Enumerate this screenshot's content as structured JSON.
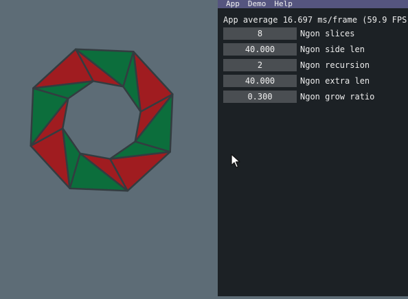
{
  "menu": [
    "App",
    "Demo",
    "Help"
  ],
  "fps_text": "App average 16.697 ms/frame (59.9 FPS)",
  "params": [
    {
      "value": "8",
      "label": "Ngon slices"
    },
    {
      "value": "40.000",
      "label": "Ngon side len"
    },
    {
      "value": "2",
      "label": "Ngon recursion"
    },
    {
      "value": "40.000",
      "label": "Ngon extra len"
    },
    {
      "value": "0.300",
      "label": "Ngon grow ratio"
    }
  ],
  "colors": {
    "background": "#5d6c76",
    "panel": "#1c2125",
    "menubar": "#55557f",
    "red": "#a01c20",
    "green": "#0c6e3c",
    "outline": "#333c40"
  }
}
